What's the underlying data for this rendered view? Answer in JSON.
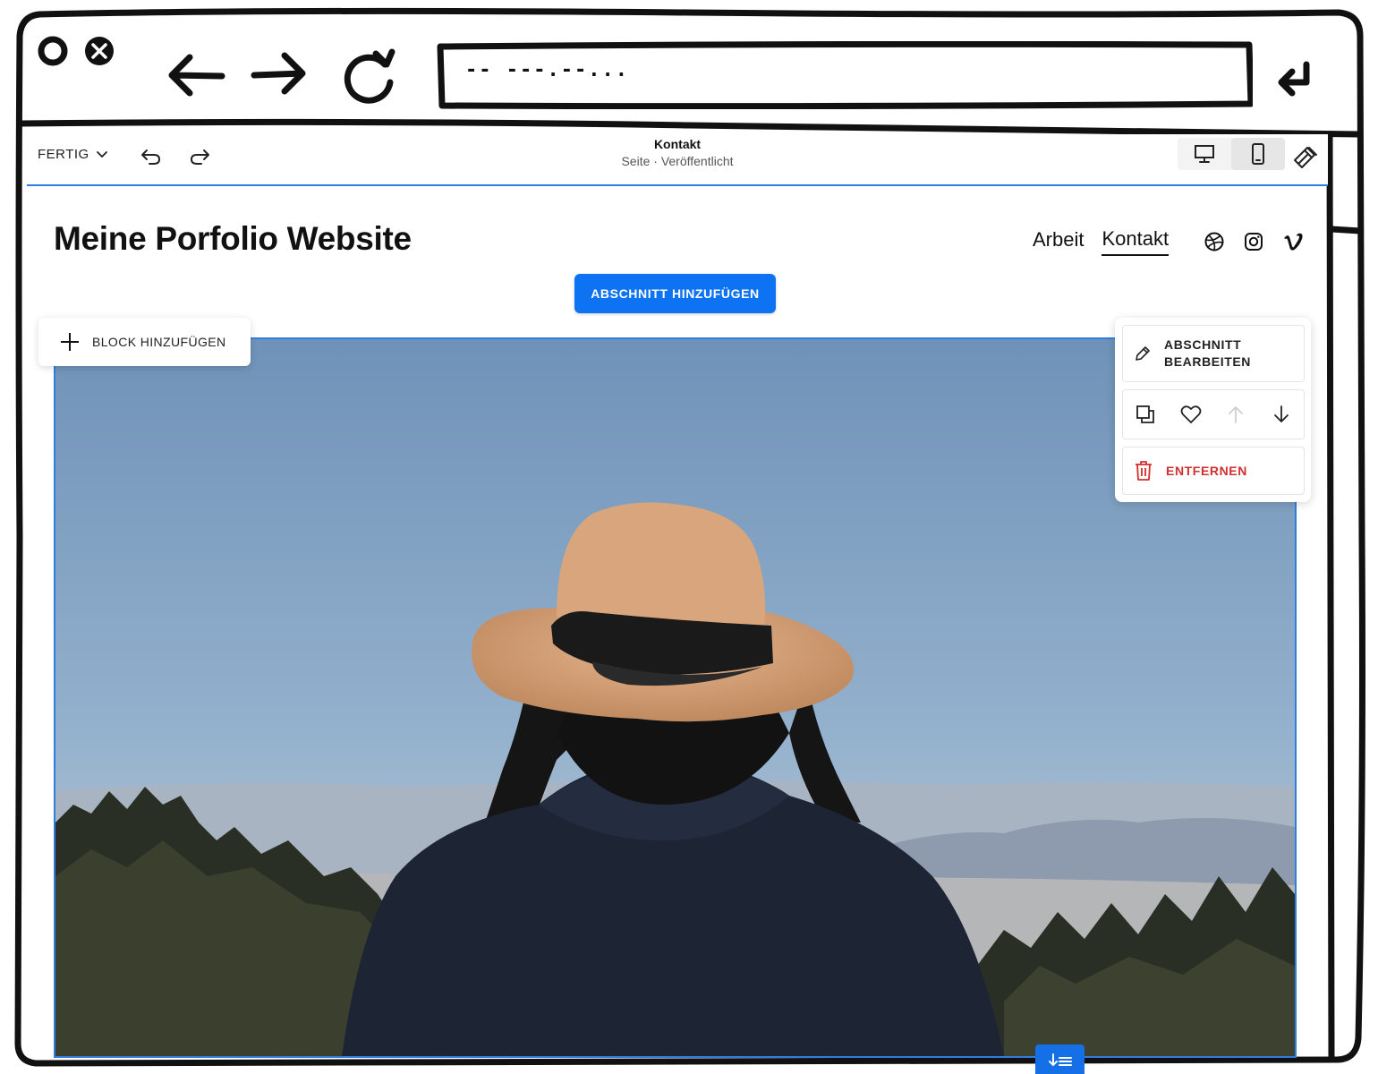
{
  "browser": {
    "url_text": "-- ---.--...",
    "icons": [
      "record-icon",
      "close-icon",
      "back-arrow-icon",
      "forward-arrow-icon",
      "reload-icon",
      "enter-icon"
    ]
  },
  "toolbar": {
    "done_label": "FERTIG",
    "page_name": "Kontakt",
    "page_status": "Seite · Veröffentlicht",
    "icons": [
      "undo-icon",
      "redo-icon",
      "desktop-icon",
      "mobile-icon",
      "design-brush-icon"
    ]
  },
  "site": {
    "title": "Meine Porfolio Website",
    "nav": [
      {
        "label": "Arbeit",
        "active": false
      },
      {
        "label": "Kontakt",
        "active": true
      }
    ],
    "social_icons": [
      "dribbble-icon",
      "instagram-icon",
      "vimeo-icon"
    ]
  },
  "editor": {
    "add_section_label": "ABSCHNITT HINZUFÜGEN",
    "add_block_label": "BLOCK HINZUFÜGEN",
    "section_panel": {
      "edit_label": "ABSCHNITT BEARBEITEN",
      "remove_label": "ENTFERNEN",
      "actions": [
        "duplicate-icon",
        "heart-icon",
        "move-up-icon",
        "move-down-icon"
      ]
    }
  },
  "colors": {
    "accent": "#0d73f2",
    "selection_border": "#2f7de1",
    "danger": "#d32f2f"
  }
}
